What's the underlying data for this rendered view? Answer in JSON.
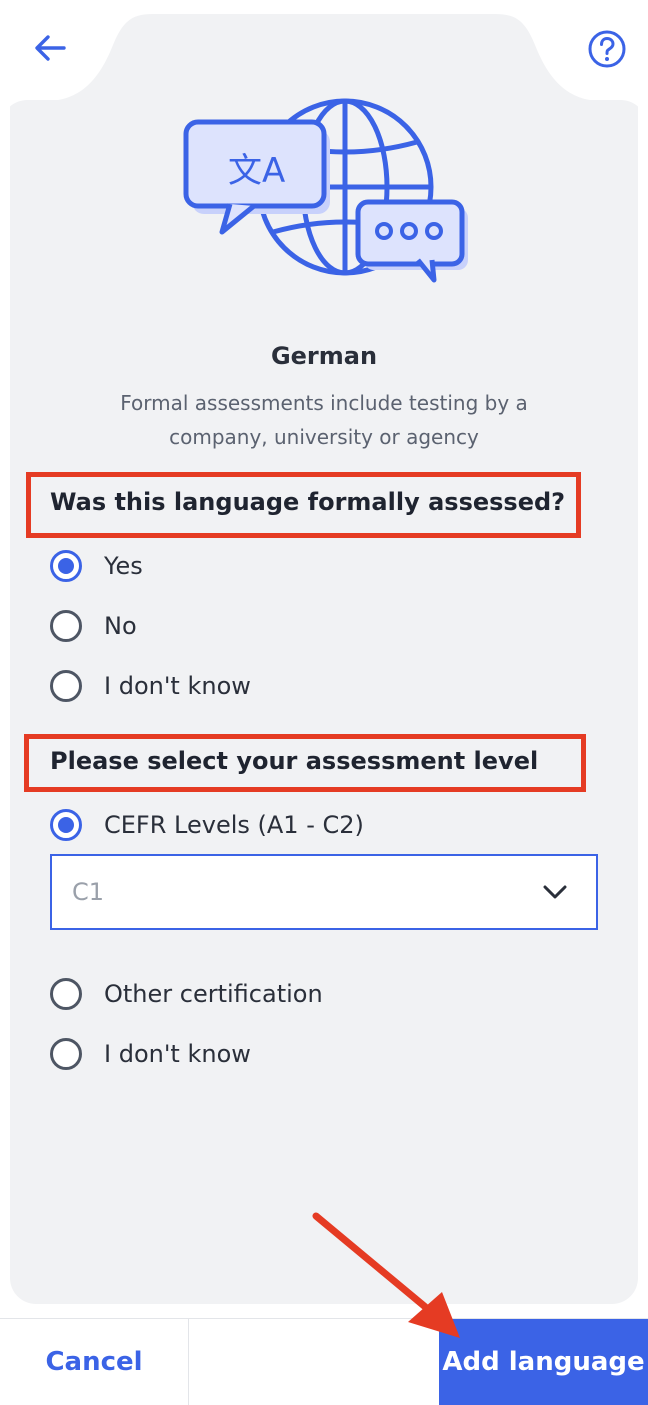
{
  "header": {
    "back_icon": "arrow-left-icon",
    "help_icon": "question-circle-icon"
  },
  "illustration": {
    "icon": "globe-translate-illustration",
    "glyph_main": "文A",
    "glyph_dots": "•••"
  },
  "language": {
    "title": "German",
    "subtitle": "Formal assessments include testing by a company, university or agency"
  },
  "question1": {
    "heading": "Was this language formally assessed?",
    "options": [
      "Yes",
      "No",
      "I don't know"
    ],
    "selected": "Yes"
  },
  "question2": {
    "heading": "Please select your assessment level",
    "options": [
      "CEFR Levels (A1 - C2)",
      "Other certification",
      "I don't know"
    ],
    "selected": "CEFR Levels (A1 - C2)",
    "dropdown": {
      "value": "C1"
    }
  },
  "footer": {
    "cancel_label": "Cancel",
    "add_label": "Add language"
  },
  "colors": {
    "accent": "#3b63e6",
    "annotation": "#e53b23",
    "card_bg": "#f1f2f4"
  }
}
